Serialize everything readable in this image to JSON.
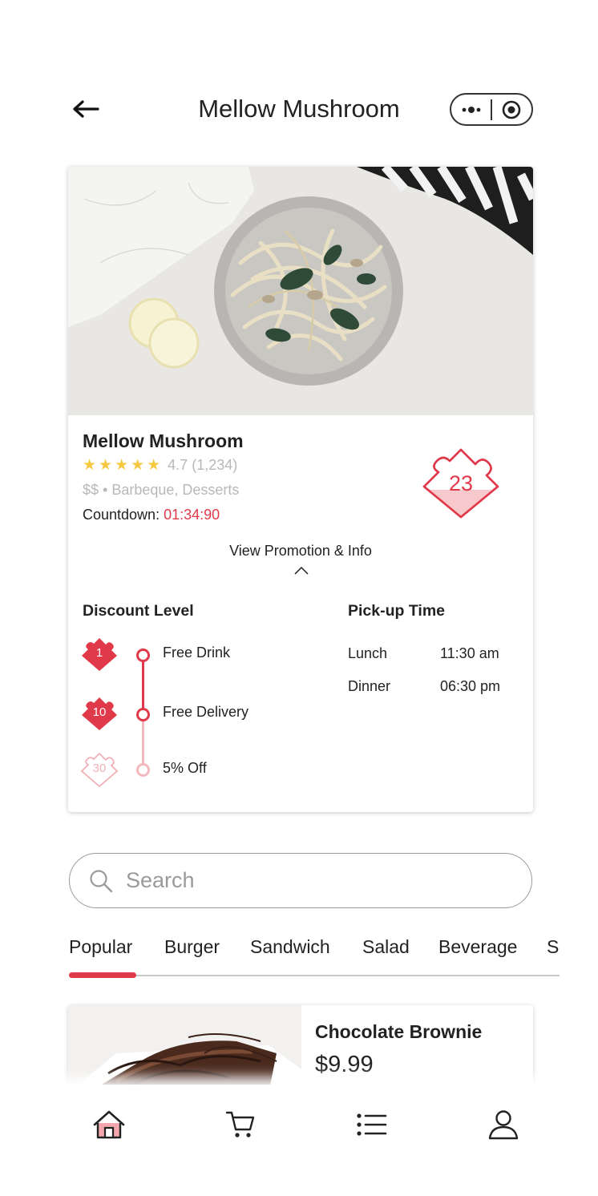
{
  "header": {
    "title": "Mellow Mushroom"
  },
  "restaurant": {
    "name": "Mellow Mushroom",
    "stars": "★★★★★",
    "rating": "4.7",
    "review_count": "(1,234)",
    "meta": "$$ • Barbeque, Desserts",
    "countdown_label": "Countdown:",
    "countdown_value": "01:34:90",
    "puzzle_count": "23",
    "view_promo_label": "View Promotion & Info"
  },
  "discount": {
    "title": "Discount Level",
    "levels": [
      {
        "number": "1",
        "label": "Free Drink",
        "reached": true
      },
      {
        "number": "10",
        "label": "Free Delivery",
        "reached": true
      },
      {
        "number": "30",
        "label": "5% Off",
        "reached": false
      }
    ]
  },
  "pickup": {
    "title": "Pick-up Time",
    "times": [
      {
        "meal": "Lunch",
        "time": "11:30 am"
      },
      {
        "meal": "Dinner",
        "time": "06:30 pm"
      }
    ]
  },
  "search": {
    "placeholder": "Search",
    "value": ""
  },
  "tabs": [
    {
      "label": "Popular",
      "active": true
    },
    {
      "label": "Burger",
      "active": false
    },
    {
      "label": "Sandwich",
      "active": false
    },
    {
      "label": "Salad",
      "active": false
    },
    {
      "label": "Beverage",
      "active": false
    },
    {
      "label": "Sides",
      "active": false
    }
  ],
  "products": [
    {
      "name": "Chocolate Brownie",
      "price": "$9.99"
    }
  ],
  "bottom_nav": {
    "items": [
      "home-icon",
      "cart-icon",
      "list-icon",
      "user-icon"
    ],
    "active": "home-icon"
  },
  "colors": {
    "accent": "#e03a4a",
    "star": "#f5c842",
    "muted_text": "#b8b8b8"
  }
}
